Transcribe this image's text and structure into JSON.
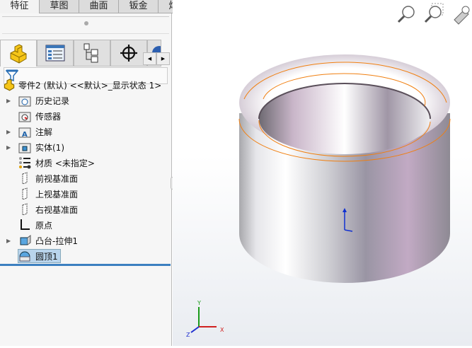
{
  "tabs": [
    "特征",
    "草图",
    "曲面",
    "钣金",
    "焊件"
  ],
  "panel": {
    "root": "零件2 (默认) <<默认>_显示状态 1>",
    "items": [
      {
        "label": "历史记录",
        "icon": "history-folder-icon",
        "expandable": true
      },
      {
        "label": "传感器",
        "icon": "sensor-folder-icon",
        "expandable": false
      },
      {
        "label": "注解",
        "icon": "annotation-folder-icon",
        "expandable": true
      },
      {
        "label": "实体(1)",
        "icon": "solid-body-folder-icon",
        "expandable": true
      },
      {
        "label": "材质 <未指定>",
        "icon": "material-icon",
        "expandable": false
      },
      {
        "label": "前视基准面",
        "icon": "plane-icon",
        "expandable": false
      },
      {
        "label": "上视基准面",
        "icon": "plane-icon",
        "expandable": false
      },
      {
        "label": "右视基准面",
        "icon": "plane-icon",
        "expandable": false
      },
      {
        "label": "原点",
        "icon": "origin-icon",
        "expandable": false
      },
      {
        "label": "凸台-拉伸1",
        "icon": "extrude-icon",
        "expandable": true
      },
      {
        "label": "圆顶1",
        "icon": "dome-icon",
        "expandable": false,
        "selected": true
      }
    ]
  },
  "triad": {
    "x": "X",
    "y": "Y",
    "z": "Z"
  },
  "colors": {
    "edge": "#f07f10",
    "selection": "#b9d4ec",
    "accent": "#3c7fc0"
  }
}
